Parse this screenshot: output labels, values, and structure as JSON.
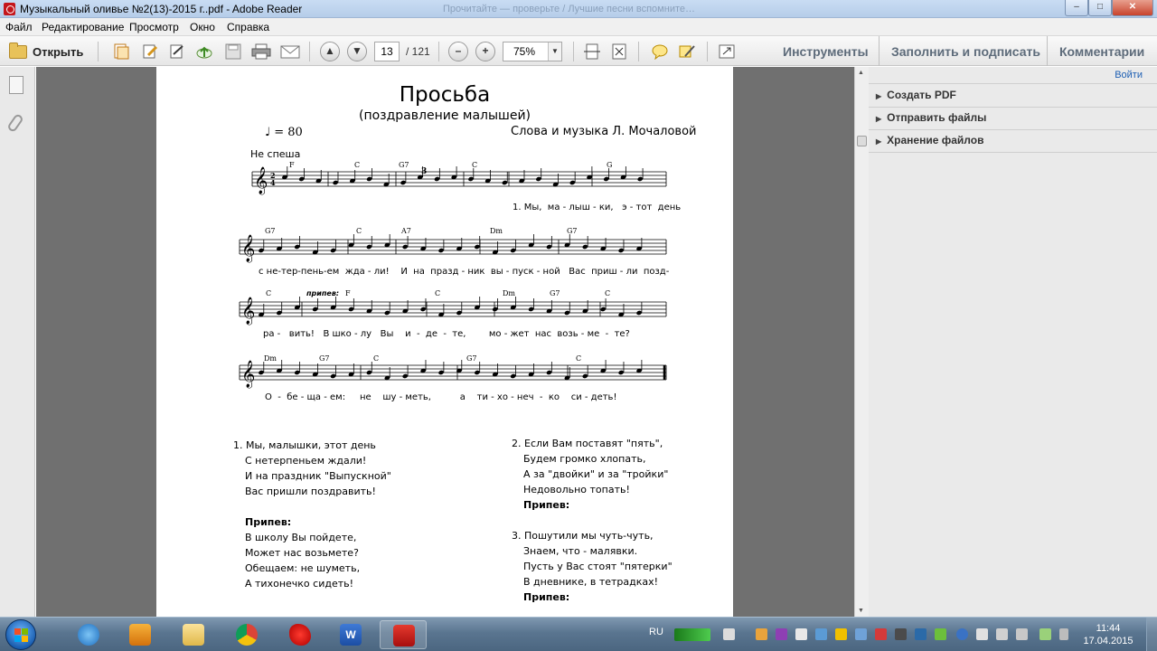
{
  "window": {
    "title": "Музыкальный оливье №2(13)-2015 г..pdf - Adobe Reader",
    "ghost_title": "Прочитайте — проверьте / Лучшие песни вспомните…",
    "controls": {
      "minimize": "–",
      "maximize": "□",
      "close": "✕"
    }
  },
  "menu": [
    "Файл",
    "Редактирование",
    "Просмотр",
    "Окно",
    "Справка"
  ],
  "toolbar": {
    "open_label": "Открыть",
    "page_current": "13",
    "page_total": "/ 121",
    "zoom": "75%",
    "zoom_out": "–",
    "zoom_in": "+",
    "prev_page": "▲",
    "next_page": "▼",
    "tabs": [
      "Инструменты",
      "Заполнить и подписать",
      "Комментарии"
    ]
  },
  "right_pane": {
    "login": "Войти",
    "items": [
      "Создать PDF",
      "Отправить файлы",
      "Хранение файлов"
    ]
  },
  "document": {
    "title": "Просьба",
    "subtitle": "(поздравление малышей)",
    "tempo": "♩ = 80",
    "authors": "Слова и музыка Л. Мочаловой",
    "tempo_word": "Не спеша",
    "refrain_mark": "припев:",
    "triplet": "3",
    "chords": {
      "row1": [
        "F",
        "C",
        "G7",
        "C",
        "G"
      ],
      "row2": [
        "G7",
        "C",
        "A7",
        "Dm",
        "G7"
      ],
      "row3": [
        "C",
        "F",
        "C",
        "Dm",
        "G7",
        "C"
      ],
      "row4": [
        "Dm",
        "G7",
        "C",
        "G7",
        "C"
      ]
    },
    "lyrics": {
      "row1": "1. Мы,  ма - лыш - ки,   э - тот  день",
      "row2": "с не-тер-пень-ем  жда - ли!    И  на  празд - ник  вы - пуск - ной   Вас  приш - ли  позд-",
      "row3": "ра -   вить!   В шко - лу   Вы    и  -  де  -  те,        мо - жет  нас  возь - ме  -  те?",
      "row4": "О  -  бе - ща - ем:     не    шу - меть,          а    ти - хо - неч  -  ко    си - деть!"
    },
    "verse_left": [
      "1. Мы, малышки, этот день",
      "С нетерпеньем ждали!",
      "И на праздник \"Выпускной\"",
      "Вас пришли поздравить!",
      "",
      "Припев:",
      "В школу Вы пойдете,",
      "Может нас возьмете?",
      "Обещаем: не шуметь,",
      "А тихонечко сидеть!"
    ],
    "verse_right": [
      "2. Если Вам поставят \"пять\",",
      "Будем громко хлопать,",
      "А за \"двойки\" и за \"тройки\"",
      "Недовольно топать!",
      "Припев:",
      "",
      "3. Пошутили мы чуть-чуть,",
      "Знаем, что - малявки.",
      "Пусть у Вас стоят \"пятерки\"",
      "В дневнике, в тетрадках!",
      "Припев:"
    ]
  },
  "taskbar": {
    "lang": "RU",
    "time": "11:44",
    "date": "17.04.2015",
    "apps": [
      "internet-explorer",
      "media-player",
      "file-explorer",
      "chrome",
      "paint-splash",
      "word",
      "adobe-reader"
    ]
  },
  "colors": {
    "doc_background": "#707070",
    "accent_link": "#1d5fb3",
    "adobe_red": "#c4161c"
  }
}
